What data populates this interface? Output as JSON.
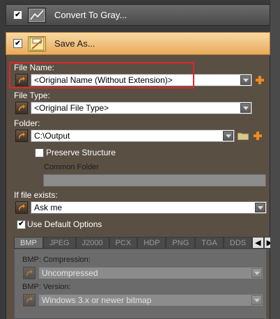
{
  "convert_section": {
    "title": "Convert To Gray...",
    "checked": true
  },
  "save_section": {
    "title": "Save As...",
    "checked": true
  },
  "file_name": {
    "label": "File Name:",
    "value": "<Original Name (Without Extension)>"
  },
  "file_type": {
    "label": "File Type:",
    "value": "<Original File Type>"
  },
  "folder": {
    "label": "Folder:",
    "value": "C:\\Output"
  },
  "preserve_structure": {
    "label": "Preserve Structure",
    "checked": false
  },
  "common_folder": {
    "label": "Common Folder",
    "value": ""
  },
  "if_exists": {
    "label": "If file exists:",
    "value": "Ask me"
  },
  "default_options": {
    "label": "Use Default Options",
    "checked": true
  },
  "format_tabs": [
    "BMP",
    "JPEG",
    "J2000",
    "PCX",
    "HDP",
    "PNG",
    "TGA",
    "DDS"
  ],
  "active_tab": "BMP",
  "bmp_compression": {
    "label": "BMP: Compression:",
    "value": "Uncompressed"
  },
  "bmp_version": {
    "label": "BMP: Version:",
    "value": "Windows 3.x or newer bitmap"
  },
  "colors": {
    "accent_orange": "#e8ab5a",
    "highlight_red": "#e0262a"
  }
}
